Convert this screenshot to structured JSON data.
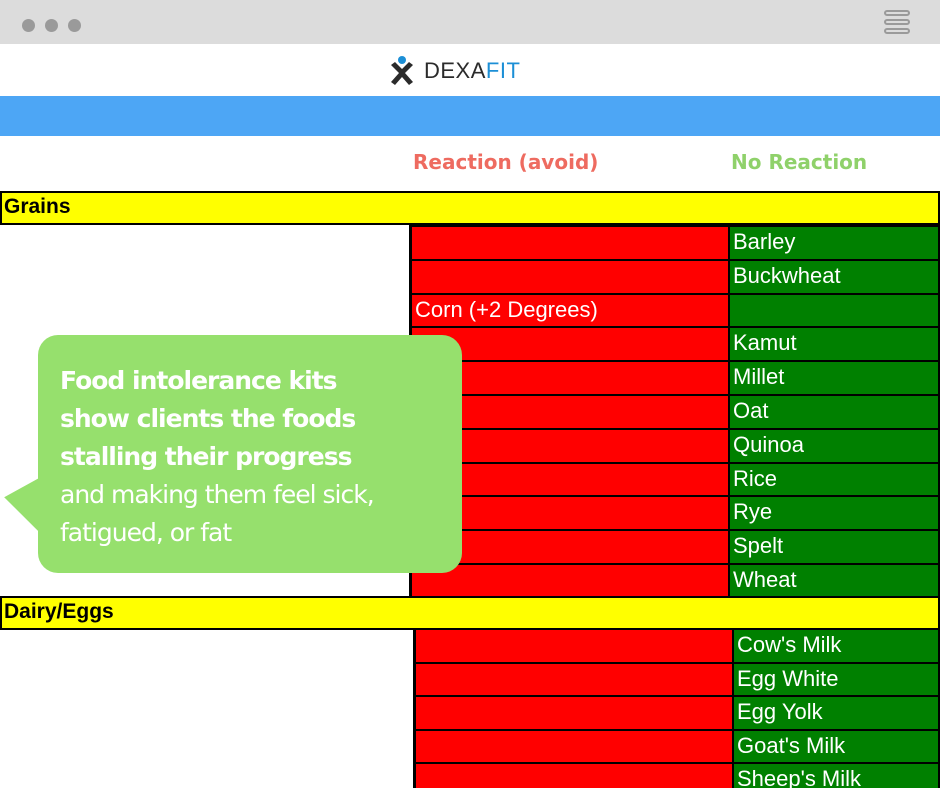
{
  "brand": {
    "prefix": "DEXA",
    "suffix": "FIT"
  },
  "columns": {
    "reaction": "Reaction (avoid)",
    "no_reaction": "No Reaction"
  },
  "sections": {
    "grains": {
      "title": "Grains",
      "rows": [
        {
          "reaction": "",
          "no_reaction": "Barley"
        },
        {
          "reaction": "",
          "no_reaction": "Buckwheat"
        },
        {
          "reaction": "Corn (+2 Degrees)",
          "no_reaction": ""
        },
        {
          "reaction": "",
          "no_reaction": "Kamut"
        },
        {
          "reaction": "",
          "no_reaction": "Millet"
        },
        {
          "reaction": "",
          "no_reaction": "Oat"
        },
        {
          "reaction": "",
          "no_reaction": "Quinoa"
        },
        {
          "reaction": "",
          "no_reaction": "Rice"
        },
        {
          "reaction": "",
          "no_reaction": "Rye"
        },
        {
          "reaction": "",
          "no_reaction": "Spelt"
        },
        {
          "reaction": "",
          "no_reaction": "Wheat"
        }
      ]
    },
    "dairy": {
      "title": "Dairy/Eggs",
      "rows": [
        {
          "reaction": "",
          "no_reaction": "Cow's Milk"
        },
        {
          "reaction": "",
          "no_reaction": "Egg White"
        },
        {
          "reaction": "",
          "no_reaction": "Egg Yolk"
        },
        {
          "reaction": "",
          "no_reaction": "Goat's Milk"
        },
        {
          "reaction": "",
          "no_reaction": "Sheep's Milk"
        }
      ]
    }
  },
  "callout": {
    "bold_lines": [
      "Food intolerance kits",
      "show clients the foods",
      "stalling their progress"
    ],
    "light_lines": [
      "and making them feel sick,",
      "fatigued, or fat"
    ]
  },
  "colors": {
    "reaction": "#ff0000",
    "no_reaction": "#008000",
    "section": "#ffff00",
    "header_bar": "#4da6f5",
    "callout": "#96e06d"
  }
}
